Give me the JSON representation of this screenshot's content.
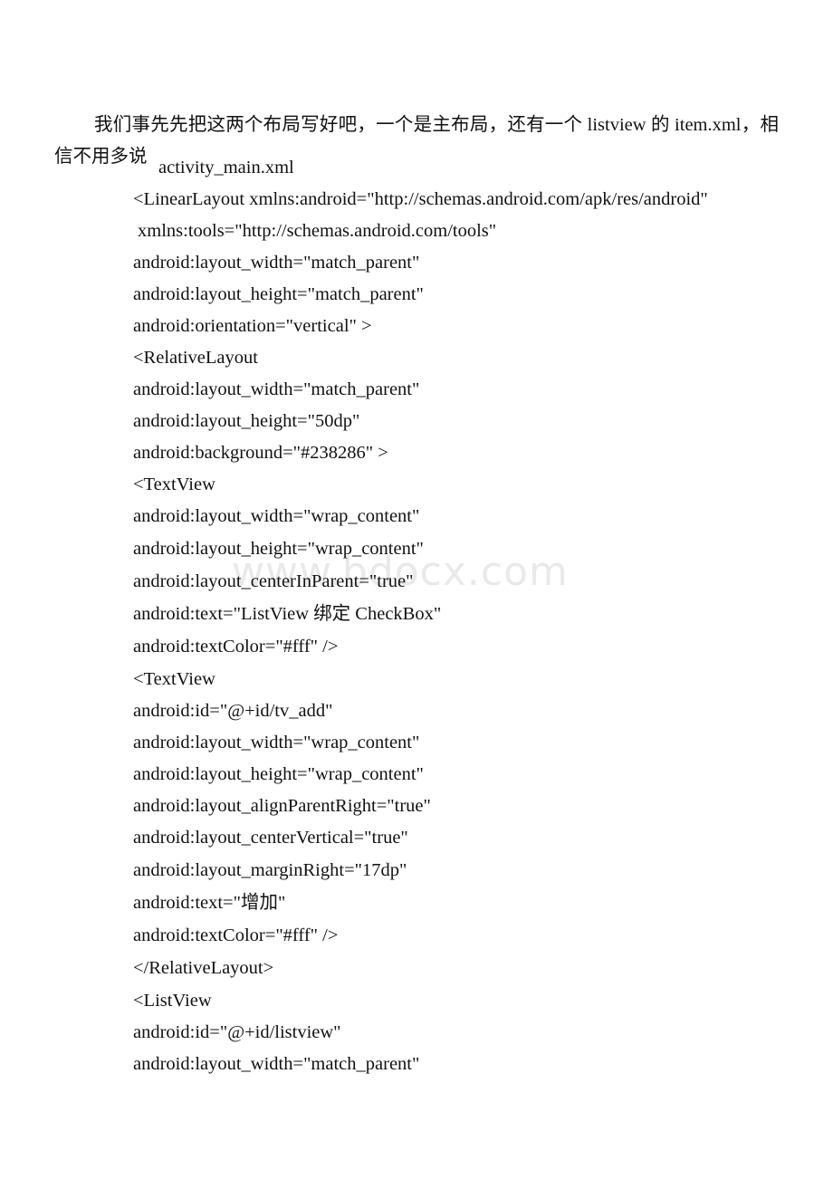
{
  "document": {
    "background_color": "#ffffff",
    "text_color": "#111111",
    "watermark": {
      "text": "www.bdocx.com",
      "color": "#e9e9e9"
    },
    "intro_paragraph": "我们事先先把这两个布局写好吧，一个是主布局，还有一个 listview 的 item.xml，相信不用多说",
    "file_label": "activity_main.xml",
    "code_lines": [
      "<LinearLayout xmlns:android=\"http://schemas.android.com/apk/res/android\"",
      "xmlns:tools=\"http://schemas.android.com/tools\"",
      "android:layout_width=\"match_parent\"",
      "android:layout_height=\"match_parent\"",
      "android:orientation=\"vertical\" >",
      "<RelativeLayout",
      "android:layout_width=\"match_parent\"",
      "android:layout_height=\"50dp\"",
      "android:background=\"#238286\" >",
      "<TextView",
      "android:layout_width=\"wrap_content\"",
      "android:layout_height=\"wrap_content\"",
      "android:layout_centerInParent=\"true\"",
      "android:text=\"ListView 绑定 CheckBox\"",
      "android:textColor=\"#fff\" />",
      "<TextView",
      "android:id=\"@+id/tv_add\"",
      "android:layout_width=\"wrap_content\"",
      "android:layout_height=\"wrap_content\"",
      "android:layout_alignParentRight=\"true\"",
      "android:layout_centerVertical=\"true\"",
      "android:layout_marginRight=\"17dp\"",
      "android:text=\"增加\"",
      "android:textColor=\"#fff\" />",
      "</RelativeLayout>",
      "<ListView",
      "android:id=\"@+id/listview\"",
      "android:layout_width=\"match_parent\""
    ]
  }
}
